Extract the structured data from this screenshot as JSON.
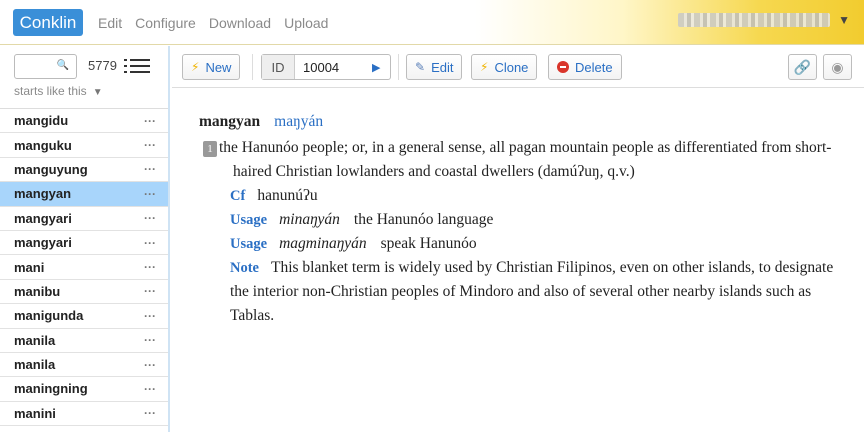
{
  "app": {
    "brand": "Conklin",
    "nav": [
      "Edit",
      "Configure",
      "Download",
      "Upload"
    ],
    "user_caret": "▼"
  },
  "sidebar": {
    "search_placeholder": "",
    "search_icon": "🔍",
    "count": "5779",
    "mode": "starts like this",
    "mode_caret": "▼",
    "selected_index": 3,
    "items": [
      {
        "label": "mangidu",
        "more": "···"
      },
      {
        "label": "manguku",
        "more": "···"
      },
      {
        "label": "manguyung",
        "more": "···"
      },
      {
        "label": "mangyan",
        "more": "···"
      },
      {
        "label": "mangyari",
        "more": "···"
      },
      {
        "label": "mangyari",
        "more": "···"
      },
      {
        "label": "mani",
        "more": "···"
      },
      {
        "label": "manibu",
        "more": "···"
      },
      {
        "label": "manigunda",
        "more": "···"
      },
      {
        "label": "manila",
        "more": "···"
      },
      {
        "label": "manila",
        "more": "···"
      },
      {
        "label": "maningning",
        "more": "···"
      },
      {
        "label": "manini",
        "more": "···"
      }
    ]
  },
  "toolbar": {
    "new_label": "New",
    "id_label": "ID",
    "id_value": "10004",
    "id_go": "▶",
    "edit_label": "Edit",
    "clone_label": "Clone",
    "delete_label": "Delete",
    "link_icon": "🔗",
    "settings_icon": "◉"
  },
  "entry": {
    "headword": "mangyan",
    "phonetic": "maŋyán",
    "sense_number": "1",
    "gloss": "the Hanunóo people; or, in a general sense, all pagan mountain people as differentiated from short-haired Christian lowlanders and coastal dwellers (damúʔuŋ, q.v.)",
    "cf_tag": "Cf",
    "cf_value": "hanunúʔu",
    "usages": [
      {
        "tag": "Usage",
        "form": "minaŋyán",
        "meaning": "the Hanunóo language"
      },
      {
        "tag": "Usage",
        "form": "magminaŋyán",
        "meaning": "speak Hanunóo"
      }
    ],
    "note_tag": "Note",
    "note": "This blanket term is widely used by Christian Filipinos, even on other islands, to designate the interior non-Christian peoples of Mindoro and also of several other nearby islands such as Tablas."
  }
}
